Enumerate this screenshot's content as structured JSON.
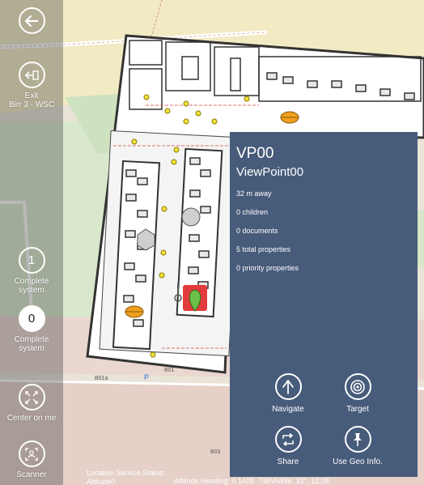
{
  "sidebar": {
    "back": {
      "icon": "back-arrow-icon"
    },
    "exit": {
      "icon": "exit-icon",
      "label_line1": "Exit",
      "label_line2": "Birr 3 - WSC"
    },
    "complete_system_1": {
      "value": "1",
      "label_line1": "Complete",
      "label_line2": "system"
    },
    "complete_system_0": {
      "value": "0",
      "label_line1": "Complete",
      "label_line2": "system"
    },
    "center_on_me": {
      "icon": "center-on-me-icon",
      "label": "Center on me"
    },
    "scanner": {
      "icon": "scanner-icon",
      "label": "Scanner"
    }
  },
  "panel": {
    "title": "VP00",
    "subtitle": "ViewPoint00",
    "distance": "32 m away",
    "children": "0 children",
    "documents": "0 documents",
    "total_properties": "5 total properties",
    "priority_properties": "0 priority properties",
    "actions": {
      "navigate": {
        "label": "Navigate",
        "icon": "navigate-arrow-icon"
      },
      "target": {
        "label": "Target",
        "icon": "target-icon"
      },
      "share": {
        "label": "Share",
        "icon": "share-icon"
      },
      "geo": {
        "label": "Use Geo Info.",
        "icon": "pin-icon"
      }
    },
    "color": "#475b7a"
  },
  "map": {
    "labels": {
      "b01a": "B01a",
      "b01": "B01",
      "b03": "B03",
      "p": "P"
    }
  },
  "status": {
    "location_service": "Location Service Status:",
    "altitude": "Altitude0",
    "attitude_heading": "Attitude Heading: 0.1409",
    "tilt": "Tilt/Visible: 33°, 12.08"
  }
}
